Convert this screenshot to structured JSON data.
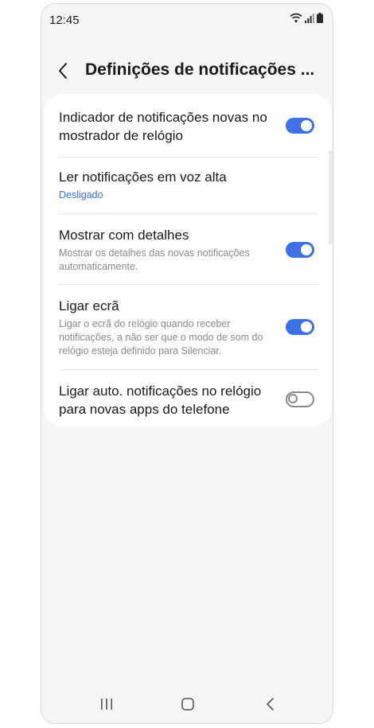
{
  "status_bar": {
    "time": "12:45",
    "icons": [
      "wifi-icon",
      "signal-icon",
      "battery-icon"
    ]
  },
  "header": {
    "title": "Definições de notificações ..."
  },
  "settings": [
    {
      "title": "Indicador de notificações novas no mostrador de relógio",
      "subtitle": "",
      "toggle": "on"
    },
    {
      "title": "Ler notificações em voz alta",
      "subtitle": "Desligado",
      "toggle": "none"
    },
    {
      "title": "Mostrar com detalhes",
      "subtitle": "Mostrar os detalhes das novas notificações automaticamente.",
      "toggle": "on"
    },
    {
      "title": "Ligar ecrã",
      "subtitle": "Ligar o ecrã do relógio quando receber notificações, a não ser que o modo de som do relógio esteja definido para Silenciar.",
      "toggle": "on"
    },
    {
      "title": "Ligar auto. notificações no relógio para novas apps do telefone",
      "subtitle": "",
      "toggle": "off"
    }
  ],
  "colors": {
    "accent": "#3e70e6",
    "link": "#3a6fd8",
    "background": "#f5f5f7"
  },
  "navigation": {
    "icons": [
      "recent-apps-icon",
      "home-icon",
      "back-icon"
    ]
  }
}
